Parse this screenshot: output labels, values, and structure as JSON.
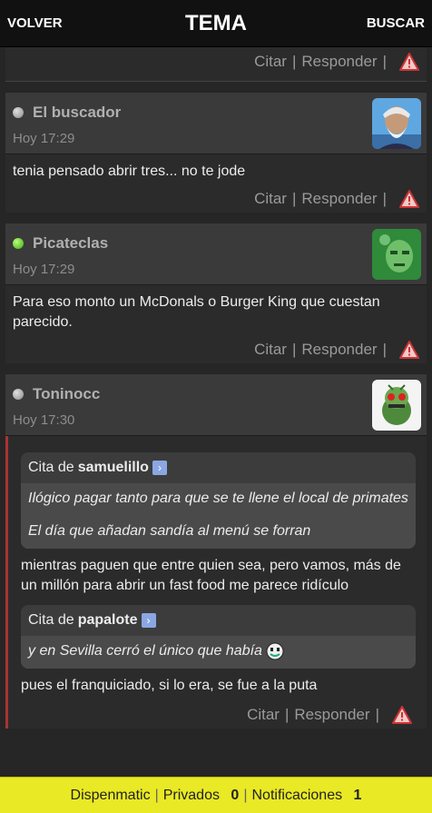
{
  "topbar": {
    "back": "VOLVER",
    "title": "TEMA",
    "search": "BUSCAR"
  },
  "actions": {
    "quote": "Citar",
    "reply": "Responder",
    "separator": "|"
  },
  "posts": [
    {
      "user": "El buscador",
      "status": "offline",
      "time": "Hoy 17:29",
      "text": "tenia pensado abrir tres... no te jode"
    },
    {
      "user": "Picateclas",
      "status": "online",
      "time": "Hoy 17:29",
      "text": "Para eso monto un McDonals o Burger King que cuestan parecido."
    },
    {
      "user": "Toninocc",
      "status": "offline",
      "time": "Hoy 17:30",
      "quotes": [
        {
          "prefix": "Cita de",
          "author": "samuelillo",
          "lines": [
            "Ilógico pagar tanto para que se te llene el local de primates",
            "El día que añadan sandía al menú se forran"
          ]
        },
        {
          "prefix": "Cita de",
          "author": "papalote",
          "lines": [
            "y en Sevilla cerró el único que había"
          ]
        }
      ],
      "text1": "mientras paguen que entre quien sea, pero vamos, más de un millón para abrir un fast food me parece ridículo",
      "text2": "pues el franquiciado, si lo era, se fue a la puta"
    }
  ],
  "footer": {
    "user": "Dispenmatic",
    "private": "Privados",
    "private_count": "0",
    "notifications": "Notificaciones",
    "notifications_count": "1"
  },
  "colors": {
    "accent_footer": "#e9e925",
    "online": "#3da811",
    "quote_bar": "#aa3333"
  }
}
